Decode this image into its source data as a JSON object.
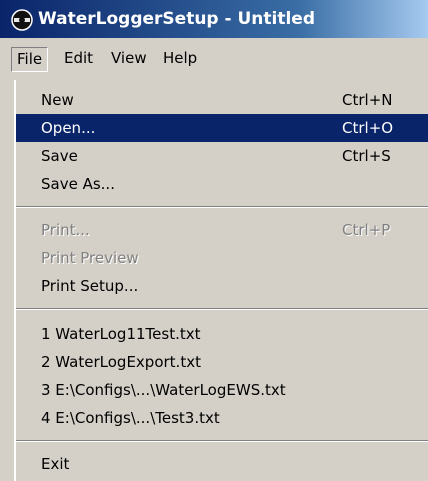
{
  "window": {
    "title": "WaterLoggerSetup - Untitled",
    "icon": "waterlogger-app-icon",
    "titlebar_color": "#0a246a"
  },
  "menubar": {
    "items": [
      {
        "label": "File",
        "active": true
      },
      {
        "label": "Edit"
      },
      {
        "label": "View"
      },
      {
        "label": "Help"
      }
    ]
  },
  "file_menu": {
    "highlight_color": "#0a246a",
    "items": [
      {
        "label": "New",
        "shortcut": "Ctrl+N"
      },
      {
        "label": "Open...",
        "shortcut": "Ctrl+O",
        "selected": true
      },
      {
        "label": "Save",
        "shortcut": "Ctrl+S"
      },
      {
        "label": "Save As...",
        "shortcut": ""
      },
      {
        "label": "Print...",
        "shortcut": "Ctrl+P",
        "disabled": true
      },
      {
        "label": "Print Preview",
        "shortcut": "",
        "disabled": true
      },
      {
        "label": "Print Setup...",
        "shortcut": ""
      },
      {
        "label": "1 WaterLog11Test.txt",
        "shortcut": ""
      },
      {
        "label": "2 WaterLogExport.txt",
        "shortcut": ""
      },
      {
        "label": "3 E:\\Configs\\...\\WaterLogEWS.txt",
        "shortcut": ""
      },
      {
        "label": "4 E:\\Configs\\...\\Test3.txt",
        "shortcut": ""
      },
      {
        "label": "Exit",
        "shortcut": ""
      }
    ]
  }
}
